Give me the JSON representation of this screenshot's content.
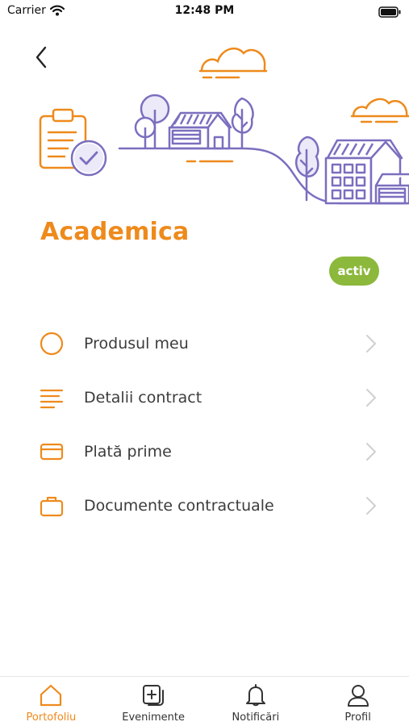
{
  "status_bar": {
    "carrier": "Carrier",
    "time": "12:48 PM"
  },
  "header": {
    "title": "Academica",
    "status": "activ"
  },
  "menu": [
    {
      "label": "Produsul meu",
      "icon": "circle-icon"
    },
    {
      "label": "Detalii contract",
      "icon": "lines-icon"
    },
    {
      "label": "Plată prime",
      "icon": "card-icon"
    },
    {
      "label": "Documente contractuale",
      "icon": "briefcase-icon"
    }
  ],
  "tabs": [
    {
      "label": "Portofoliu",
      "icon": "home-icon",
      "active": true
    },
    {
      "label": "Evenimente",
      "icon": "documents-icon",
      "active": false
    },
    {
      "label": "Notificări",
      "icon": "bell-icon",
      "active": false
    },
    {
      "label": "Profil",
      "icon": "user-icon",
      "active": false
    }
  ],
  "colors": {
    "accent": "#ee8a1c",
    "illustration": "#7a6fbf",
    "badge": "#8cb83c",
    "text": "#3c3c3c"
  }
}
